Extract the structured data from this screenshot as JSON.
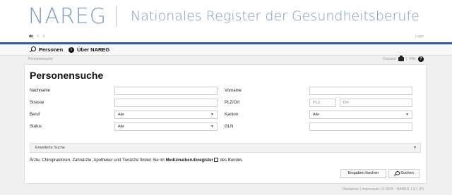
{
  "header": {
    "logo": "NAREG",
    "title": "Nationales Register der Gesundheitsberufe",
    "languages": [
      {
        "label": "de",
        "active": true
      },
      {
        "label": "fr",
        "active": false
      },
      {
        "label": "it",
        "active": false
      }
    ],
    "login": "Login"
  },
  "nav": {
    "personen": "Personen",
    "ueber": "Über NAREG"
  },
  "breadcrumb": "Personensuche",
  "tools": {
    "print": "Drucken",
    "separator": "|",
    "help": "Hilfe"
  },
  "page_title": "Personensuche",
  "form": {
    "nachname_label": "Nachname",
    "vorname_label": "Vorname",
    "strasse_label": "Strasse",
    "plzort_label": "PLZ/Ort",
    "plz_placeholder": "PLZ",
    "ort_placeholder": "Ort",
    "beruf_label": "Beruf",
    "beruf_value": "Alle",
    "kanton_label": "Kanton",
    "kanton_value": "Alle",
    "status_label": "Status",
    "status_value": "Alle",
    "gln_label": "GLN"
  },
  "extended_search": "Erweiterte Suche",
  "note": {
    "prefix": "Ärzte, Chiropraktoren, Zahnärzte, Apotheker und Tierärzte finden Sie im ",
    "link": "Medizinalberuferegister",
    "suffix": " des Bundes"
  },
  "buttons": {
    "clear": "Eingaben löschen",
    "search": "Suchen"
  },
  "footer": "Disclaimer | Impressum | © 2016 - NAREG 1.3.1 (P)"
}
